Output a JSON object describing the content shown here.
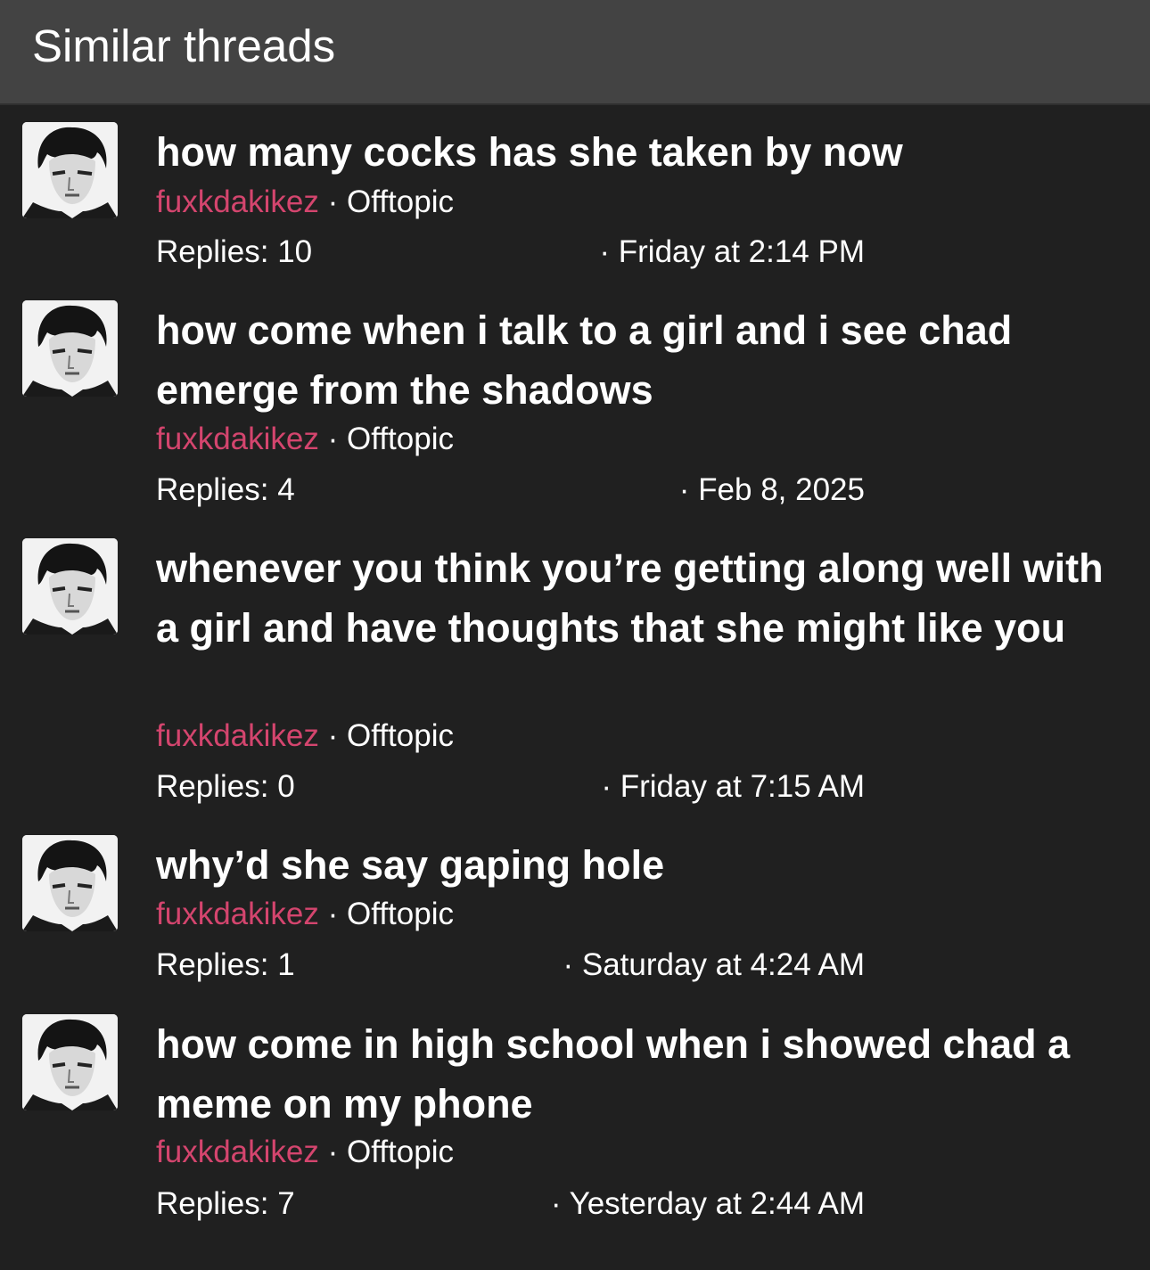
{
  "header": {
    "title": "Similar threads"
  },
  "threads": [
    {
      "title": "how many cocks has she taken by now",
      "author": "fuxkdakikez",
      "separator": "·",
      "forum": "Offtopic",
      "replies_label": "Replies:",
      "replies": "10",
      "date": "· Friday at 2:14 PM",
      "avatar_icon": "avatar-icon"
    },
    {
      "title": "how come when i talk to a girl and i see chad emerge from the shadows",
      "author": "fuxkdakikez",
      "separator": "·",
      "forum": "Offtopic",
      "replies_label": "Replies:",
      "replies": "4",
      "date": "· Feb 8, 2025",
      "avatar_icon": "avatar-icon"
    },
    {
      "title": "whenever you think you’re getting along well with a girl and have thoughts that she might like you",
      "author": "fuxkdakikez",
      "separator": "·",
      "forum": "Offtopic",
      "replies_label": "Replies:",
      "replies": "0",
      "date": "· Friday at 7:15 AM",
      "avatar_icon": "avatar-icon"
    },
    {
      "title": "why’d she say gaping hole",
      "author": "fuxkdakikez",
      "separator": "·",
      "forum": "Offtopic",
      "replies_label": "Replies:",
      "replies": "1",
      "date": "· Saturday at 4:24 AM",
      "avatar_icon": "avatar-icon"
    },
    {
      "title": "how come in high school when i showed chad a meme on my phone",
      "author": "fuxkdakikez",
      "separator": "·",
      "forum": "Offtopic",
      "replies_label": "Replies:",
      "replies": "7",
      "date": "· Yesterday at 2:44 AM",
      "avatar_icon": "avatar-icon"
    }
  ],
  "colors": {
    "background": "#202020",
    "header_background": "#434343",
    "author": "#d4456e",
    "text": "#ffffff"
  }
}
